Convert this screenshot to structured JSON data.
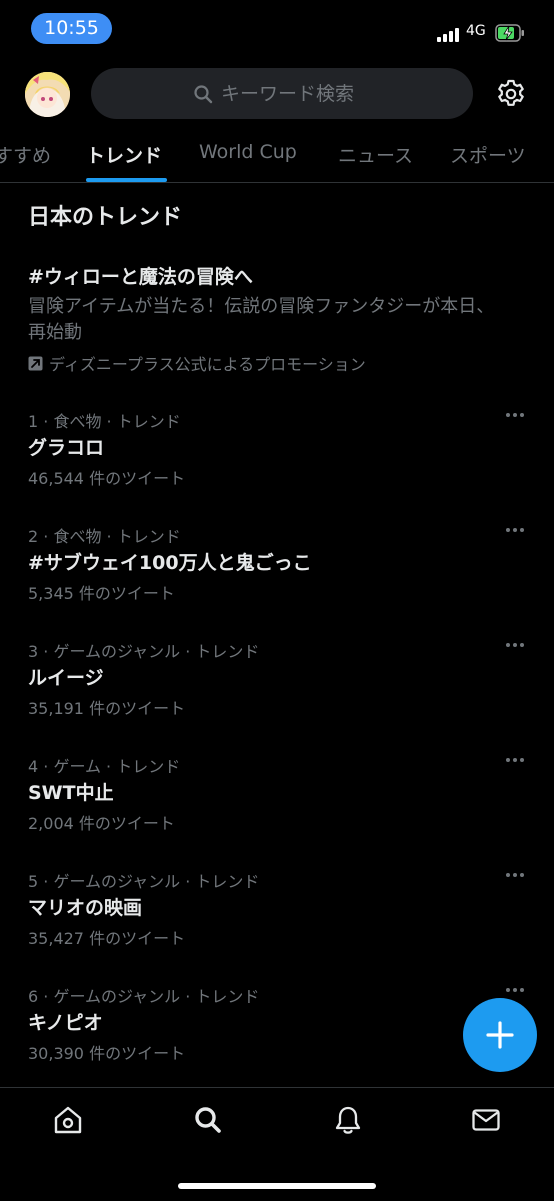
{
  "status_bar": {
    "time": "10:55",
    "network": "4G",
    "battery_color": "#4cd964",
    "time_pill_color": "#3e8ef5"
  },
  "header": {
    "avatar": "user-avatar",
    "search_placeholder": "キーワード検索",
    "settings_icon": "gear-icon"
  },
  "tabs": [
    {
      "label": "すすめ",
      "active": false
    },
    {
      "label": "トレンド",
      "active": true
    },
    {
      "label": "World Cup",
      "active": false
    },
    {
      "label": "ニュース",
      "active": false
    },
    {
      "label": "スポーツ",
      "active": false
    }
  ],
  "section_title": "日本のトレンド",
  "promoted": {
    "title": "#ウィローと魔法の冒険へ",
    "description": "冒険アイテムが当たる！伝説の冒険ファンタジーが本日、再始動",
    "promoted_by": "ディズニープラス公式によるプロモーション"
  },
  "trends": [
    {
      "context": "1 · 食べ物 · トレンド",
      "name": "グラコロ",
      "count": "46,544 件のツイート"
    },
    {
      "context": "2 · 食べ物 · トレンド",
      "name": "#サブウェイ100万人と鬼ごっこ",
      "count": "5,345 件のツイート"
    },
    {
      "context": "3 · ゲームのジャンル · トレンド",
      "name": "ルイージ",
      "count": "35,191 件のツイート"
    },
    {
      "context": "4 · ゲーム · トレンド",
      "name": "SWT中止",
      "count": "2,004 件のツイート"
    },
    {
      "context": "5 · ゲームのジャンル · トレンド",
      "name": "マリオの映画",
      "count": "35,427 件のツイート"
    },
    {
      "context": "6 · ゲームのジャンル · トレンド",
      "name": "キノピオ",
      "count": "30,390 件のツイート"
    }
  ],
  "colors": {
    "background": "#000000",
    "accent": "#1d9bf0",
    "primary_text": "#e7e9ea",
    "secondary_text": "#71767b",
    "divider": "#2f3336",
    "search_bg": "#212327"
  },
  "bottom_nav": [
    "home-icon",
    "search-icon",
    "bell-icon",
    "mail-icon"
  ]
}
